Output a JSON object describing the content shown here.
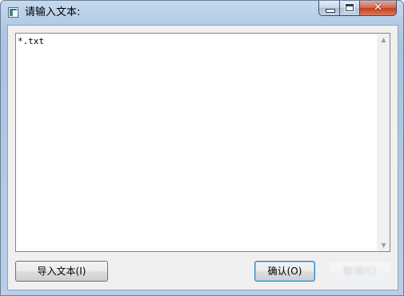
{
  "window": {
    "title": "请输入文本:",
    "close_symbol": "✕"
  },
  "editor": {
    "content": "*.txt",
    "scroll_up_symbol": "▲",
    "scroll_down_symbol": "▼"
  },
  "buttons": {
    "import_label": "导入文本(I)",
    "ok_label": "确认(O)",
    "cancel_label": "取消(C)"
  },
  "icons": {
    "app": "app-window-icon",
    "minimize": "minimize-icon",
    "maximize": "maximize-icon",
    "close": "close-icon"
  },
  "colors": {
    "close_button": "#c2401f",
    "ok_button_border": "#3c7fb1"
  }
}
